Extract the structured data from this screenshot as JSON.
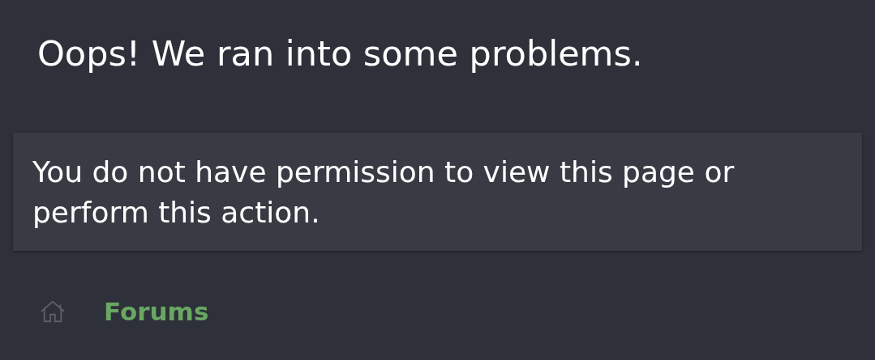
{
  "title": "Oops! We ran into some problems.",
  "message": "You do not have permission to view this page or perform this action.",
  "breadcrumb": {
    "label": "Forums"
  }
}
